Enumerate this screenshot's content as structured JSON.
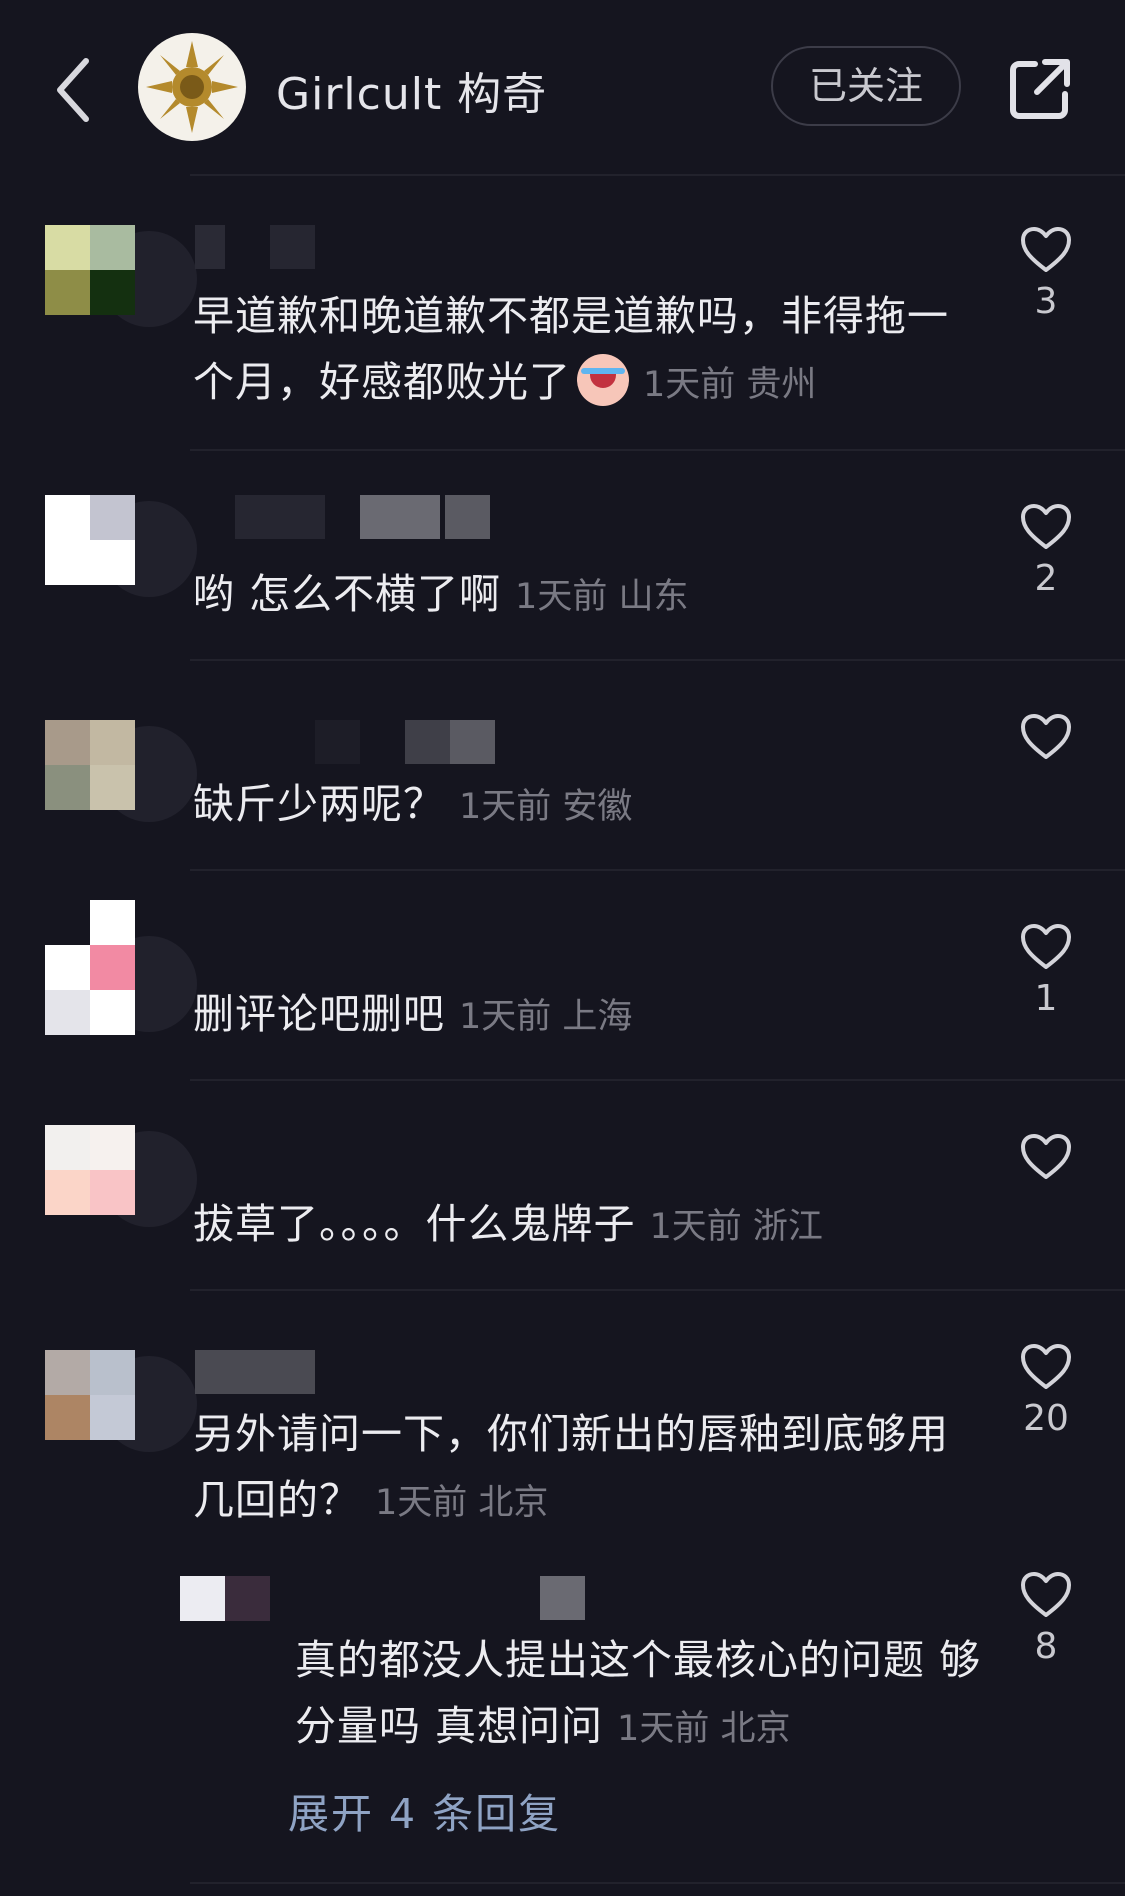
{
  "header": {
    "title": "Girlcult 构奇",
    "follow_label": "已关注"
  },
  "comments": [
    {
      "text": "早道歉和晚道歉不都是道歉吗，非得拖一个月，好感都败光了",
      "emoji": "crying-laughing-emoji",
      "time": "1天前",
      "location": "贵州",
      "likes": "3"
    },
    {
      "text": "哟 怎么不横了啊",
      "time": "1天前",
      "location": "山东",
      "likes": "2"
    },
    {
      "text": "缺斤少两呢？",
      "time": "1天前",
      "location": "安徽",
      "likes": ""
    },
    {
      "text": "删评论吧删吧",
      "time": "1天前",
      "location": "上海",
      "likes": "1"
    },
    {
      "text": "拔草了。。。。什么鬼牌子",
      "time": "1天前",
      "location": "浙江",
      "likes": ""
    },
    {
      "text": "另外请问一下，你们新出的唇釉到底够用几回的？",
      "time": "1天前",
      "location": "北京",
      "likes": "20"
    }
  ],
  "reply": {
    "text": "真的都没人提出这个最核心的问题 够分量吗 真想问问",
    "time": "1天前",
    "location": "北京",
    "likes": "8"
  },
  "expand_label": "展开 4 条回复"
}
